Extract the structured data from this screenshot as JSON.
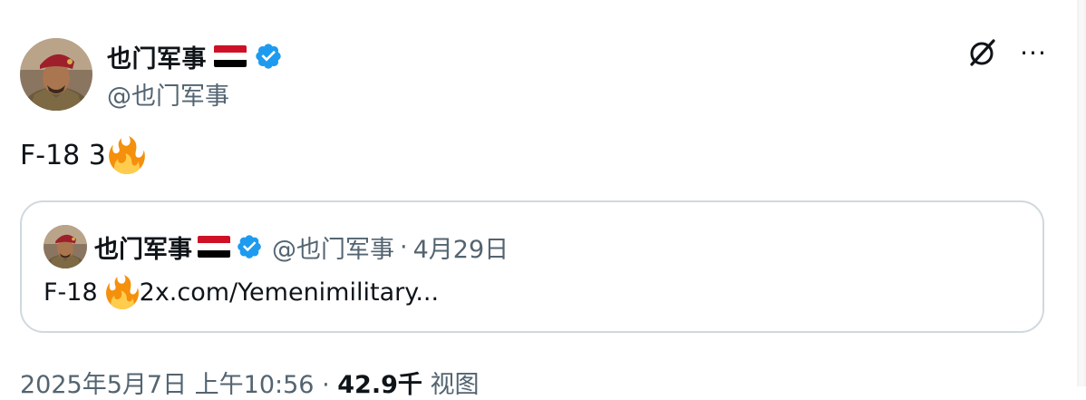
{
  "author": {
    "display_name": "也门军事",
    "handle": "@也门军事",
    "verified": true,
    "avatar_icon": "military-officer-avatar",
    "flag_icon": "yemen-flag-icon",
    "flag_colors": [
      "#ce1126",
      "#ffffff",
      "#000000"
    ]
  },
  "toolbar": {
    "grok_icon": "grok-icon",
    "more_icon": "more-options-icon",
    "more_label": "···"
  },
  "tweet": {
    "text": "F-18 3",
    "emoji": "fire-emoji"
  },
  "quote": {
    "display_name": "也门军事",
    "handle": "@也门军事",
    "separator": "·",
    "date": "4月29日",
    "text_prefix": "F-18",
    "text_suffix": "2x.com/Yemenimilitary...",
    "emoji": "fire-emoji"
  },
  "meta": {
    "timestamp": "2025年5月7日 上午10:56",
    "separator": "·",
    "views_count": "42.9千",
    "views_label": "视图"
  },
  "colors": {
    "verified_blue": "#1d9bf0",
    "secondary_text": "#536471",
    "border": "#cfd9de"
  }
}
